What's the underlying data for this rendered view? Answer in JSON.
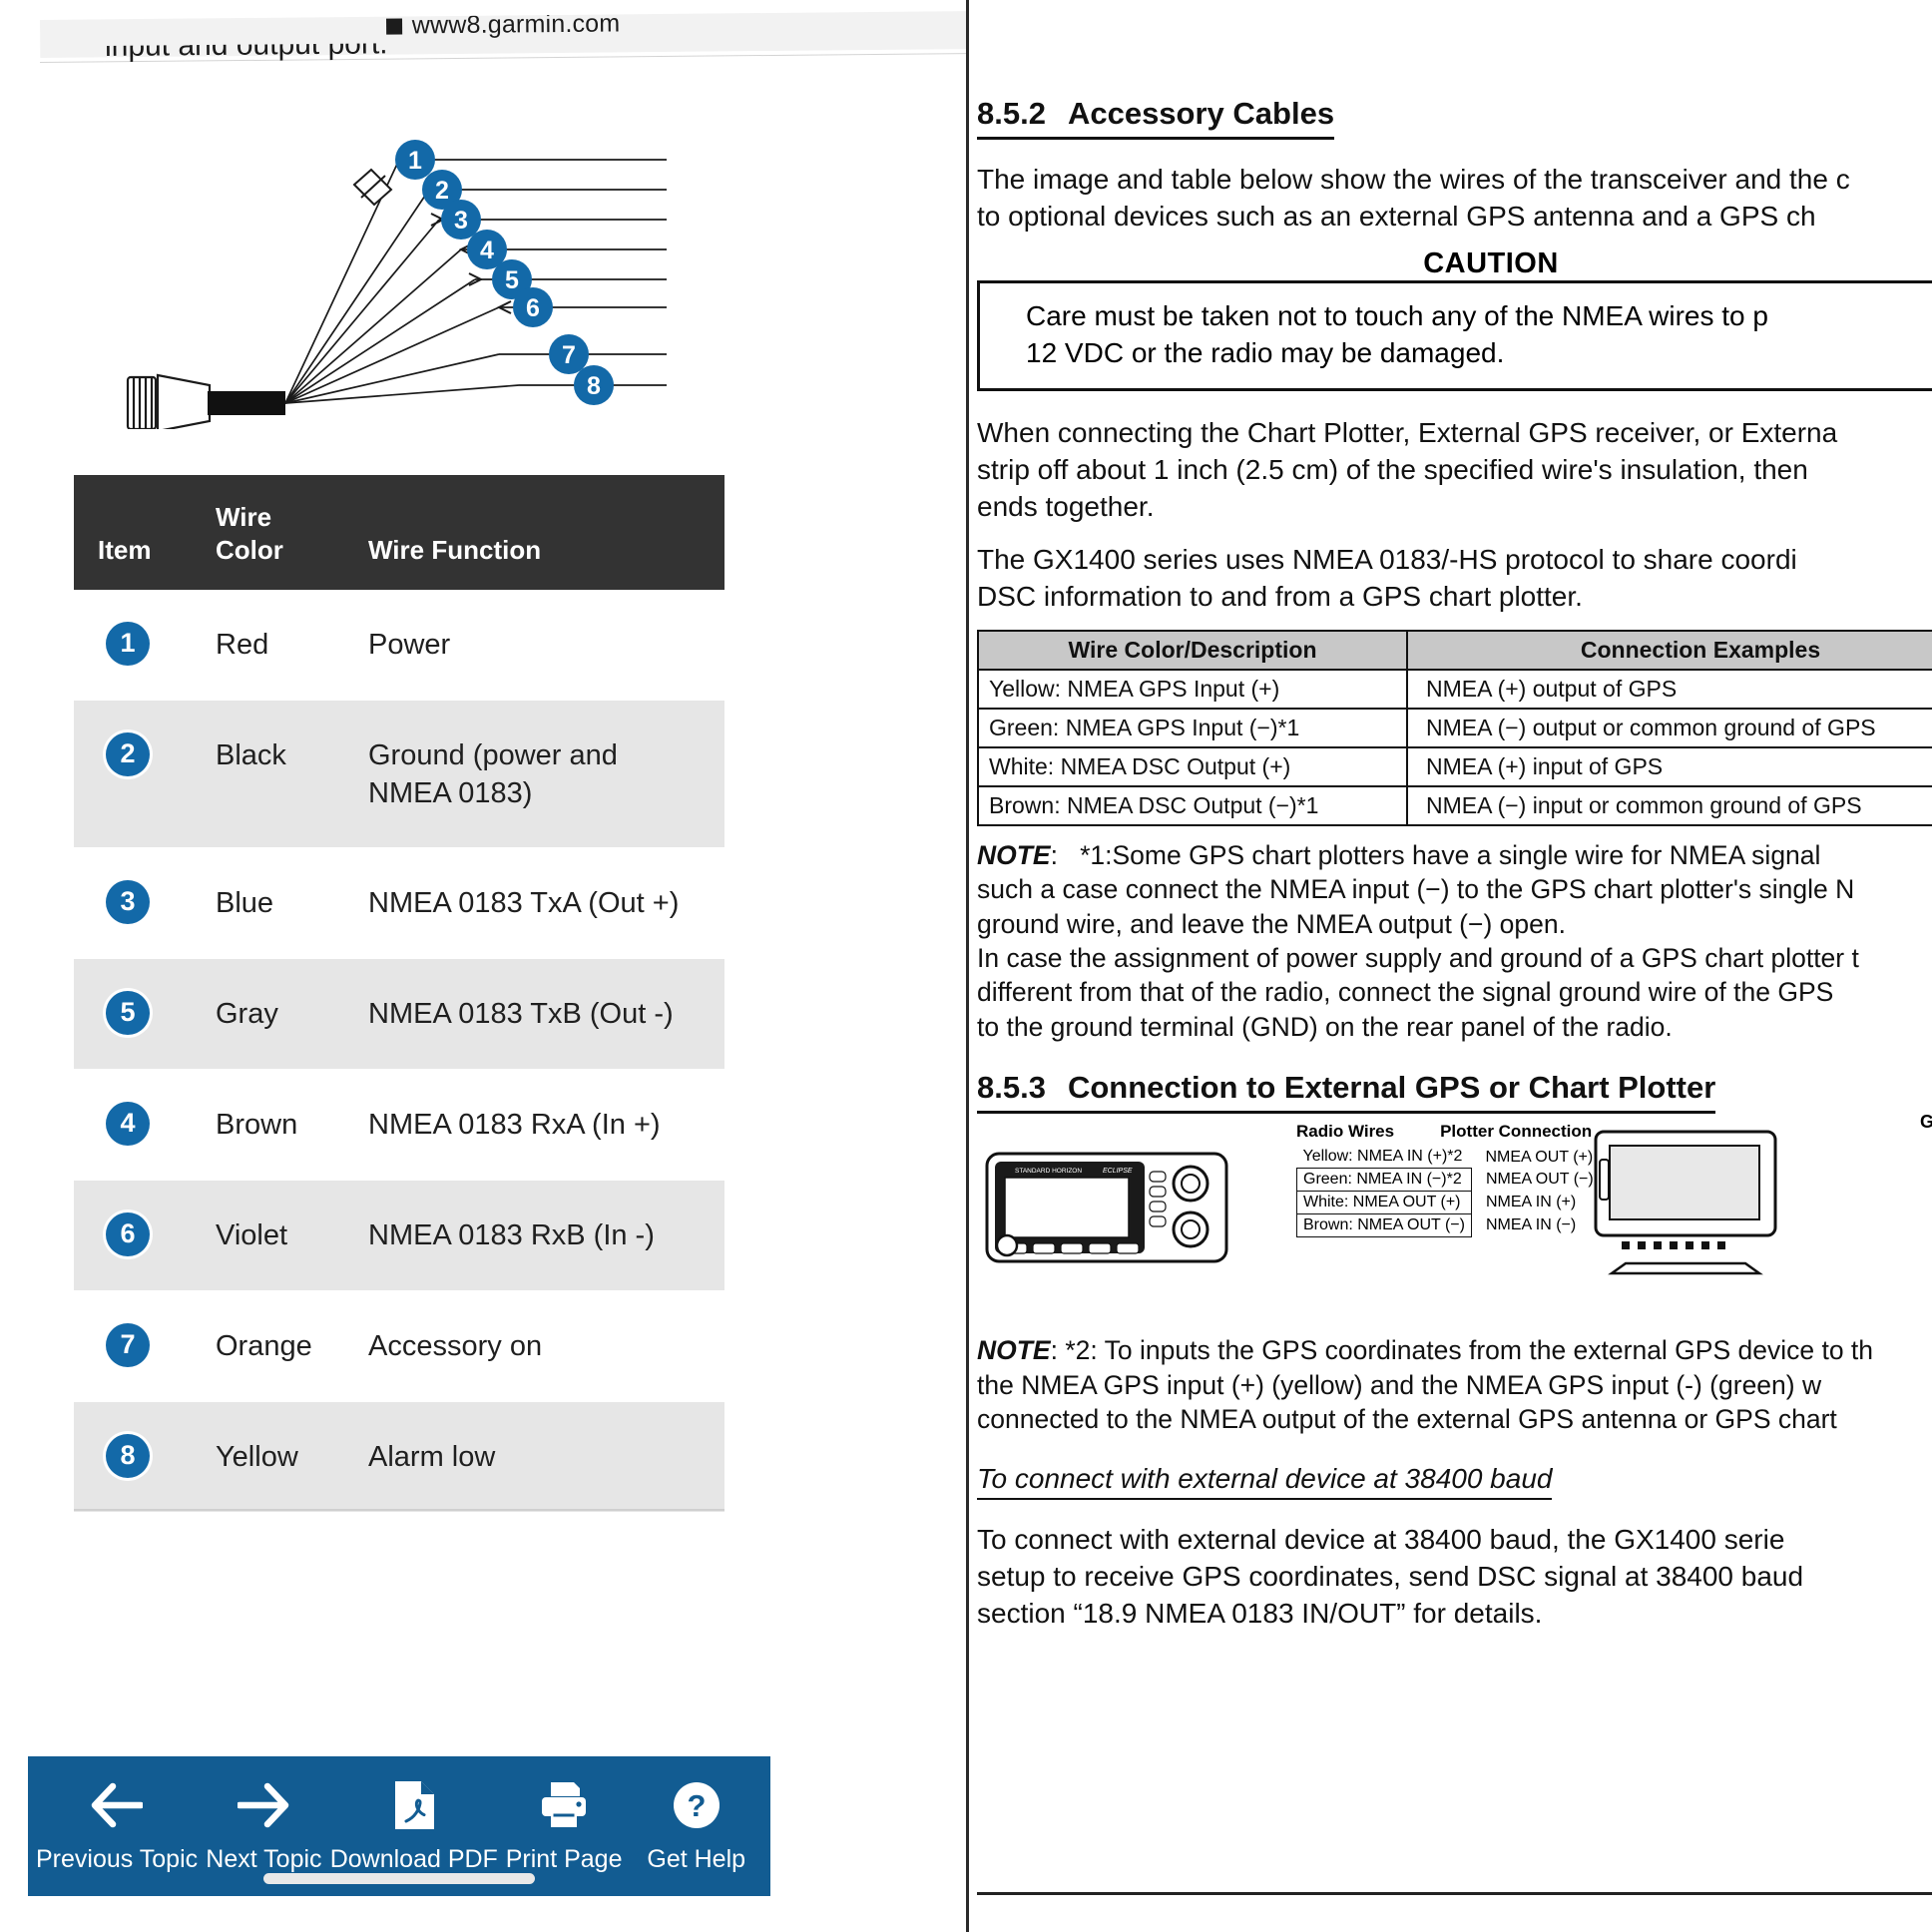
{
  "browser": {
    "url": "www8.garmin.com",
    "lock_icon": "secure-square-icon",
    "clipped_text": "input and output port."
  },
  "cable_diagram": {
    "callouts": [
      "1",
      "2",
      "3",
      "4",
      "5",
      "6",
      "7",
      "8"
    ],
    "accent_color": "#1369a8"
  },
  "wire_table": {
    "headers": {
      "item": "Item",
      "color_line1": "Wire",
      "color_line2": "Color",
      "function": "Wire Function"
    },
    "rows": [
      {
        "item": "1",
        "color": "Red",
        "function": "Power"
      },
      {
        "item": "2",
        "color": "Black",
        "function": "Ground (power and NMEA 0183)"
      },
      {
        "item": "3",
        "color": "Blue",
        "function": "NMEA 0183 TxA (Out +)"
      },
      {
        "item": "5",
        "color": "Gray",
        "function": "NMEA 0183 TxB (Out -)"
      },
      {
        "item": "4",
        "color": "Brown",
        "function": "NMEA 0183 RxA (In +)"
      },
      {
        "item": "6",
        "color": "Violet",
        "function": "NMEA 0183 RxB (In -)"
      },
      {
        "item": "7",
        "color": "Orange",
        "function": "Accessory on"
      },
      {
        "item": "8",
        "color": "Yellow",
        "function": "Alarm low"
      }
    ]
  },
  "action_bar": {
    "background": "#125c92",
    "actions": [
      {
        "label": "Previous Topic",
        "icon": "arrow-left-icon"
      },
      {
        "label": "Next Topic",
        "icon": "arrow-right-icon"
      },
      {
        "label": "Download PDF",
        "icon": "pdf-file-icon"
      },
      {
        "label": "Print Page",
        "icon": "printer-icon"
      },
      {
        "label": "Get Help",
        "icon": "question-circle-icon"
      }
    ]
  },
  "pdf": {
    "section_852": {
      "number": "8.5.2",
      "title": "Accessory Cables"
    },
    "intro_line1": "The image and table below show the wires of the transceiver and the c",
    "intro_line2": "to optional devices such as an external GPS antenna and a GPS ch",
    "caution_title": "CAUTION",
    "caution_line1": "Care must be taken not to touch any of the NMEA wires to p",
    "caution_line2": "12 VDC or the radio may be damaged.",
    "para2_line1": "When connecting the Chart Plotter, External GPS receiver, or Externa",
    "para2_line2": "strip off about 1 inch (2.5 cm) of the specified wire's insulation, then",
    "para2_line3": "ends together.",
    "para3_line1": "The GX1400 series uses NMEA 0183/-HS protocol to share coordi",
    "para3_line2": "DSC information to and from a GPS chart plotter.",
    "mini_table": {
      "headers": [
        "Wire Color/Description",
        "Connection Examples"
      ],
      "rows": [
        [
          "Yellow:  NMEA GPS Input (+)",
          "NMEA (+) output of GPS"
        ],
        [
          "Green:  NMEA GPS Input (−)*1",
          "NMEA (−) output or common ground of GPS"
        ],
        [
          "White:  NMEA DSC Output (+)",
          "NMEA (+) input of GPS"
        ],
        [
          "Brown:  NMEA DSC Output (−)*1",
          "NMEA (−) input or common ground of GPS"
        ]
      ]
    },
    "note1_label": "NOTE",
    "note1_line1": "*1:Some GPS chart plotters have a single wire for NMEA signal",
    "note1_line2": "such a case connect the NMEA input (−) to the GPS chart plotter's single N",
    "note1_line3": "ground wire, and leave the NMEA output (−) open.",
    "note1_line4": "In case the assignment of power supply and ground of a GPS chart plotter t",
    "note1_line5": "different from that of the radio, connect the signal ground wire of the GPS",
    "note1_line6": "to the ground terminal (GND) on the rear panel of the radio.",
    "section_853": {
      "number": "8.5.3",
      "title": "Connection to External GPS or Chart Plotter"
    },
    "schematic": {
      "plotter_label": "GPS Cha",
      "radio_brand": "STANDARD HORIZON",
      "radio_model": "ECLIPSE",
      "col_radio": "Radio Wires",
      "col_plotter": "Plotter Connection",
      "rows": [
        [
          "Yellow:  NMEA IN (+)*2",
          "NMEA OUT (+)"
        ],
        [
          "Green:  NMEA IN (−)*2",
          "NMEA OUT (−)"
        ],
        [
          "White:  NMEA OUT (+)",
          "NMEA IN (+)"
        ],
        [
          "Brown:  NMEA OUT (−)",
          "NMEA IN (−)"
        ]
      ]
    },
    "note2_label": "NOTE",
    "note2_line1": "*2: To inputs the GPS coordinates from the external GPS device to th",
    "note2_line2": "the NMEA GPS input (+) (yellow) and the NMEA GPS input (-) (green) w",
    "note2_line3": "connected to the NMEA output of the external GPS antenna or GPS chart",
    "subhead_baud": "To connect with external device at 38400 baud",
    "para4_line1": "To connect with external device at 38400 baud, the GX1400 serie",
    "para4_line2": "setup to receive GPS coordinates, send DSC signal at 38400 baud",
    "para4_line3": "section “18.9 NMEA 0183 IN/OUT” for details."
  }
}
